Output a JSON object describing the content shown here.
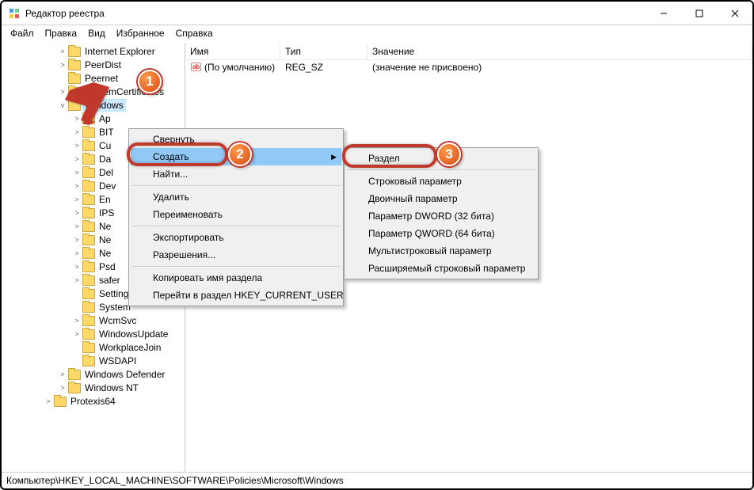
{
  "window": {
    "title": "Редактор реестра"
  },
  "menu": {
    "file": "Файл",
    "edit": "Правка",
    "view": "Вид",
    "favorites": "Избранное",
    "help": "Справка"
  },
  "list": {
    "headers": {
      "name": "Имя",
      "type": "Тип",
      "value": "Значение"
    },
    "row0": {
      "name": "(По умолчанию)",
      "type": "REG_SZ",
      "value": "(значение не присвоено)"
    }
  },
  "tree": {
    "ie": "Internet Explorer",
    "peerdist": "PeerDist",
    "peernet": "Peernet",
    "syscert": "SystemCertificates",
    "windows": "Windows",
    "ap": "Ap",
    "bit": "BIT",
    "cu": "Cu",
    "da": "Da",
    "del": "Del",
    "dev": "Dev",
    "enh": "En",
    "ips": "IPS",
    "ne1": "Ne",
    "ne2": "Ne",
    "ne3": "Ne",
    "psd": "Psd",
    "safer": "safer",
    "settingsync": "SettingSync",
    "system": "System",
    "wcmsvc": "WcmSvc",
    "winupdate": "WindowsUpdate",
    "workplace": "WorkplaceJoin",
    "wsdapi": "WSDAPI",
    "defender": "Windows Defender",
    "winnt": "Windows NT",
    "protexis": "Protexis64"
  },
  "ctx1": {
    "collapse": "Свернуть",
    "new": "Создать",
    "find": "Найти...",
    "delete": "Удалить",
    "rename": "Переименовать",
    "export": "Экспортировать",
    "permissions": "Разрешения...",
    "copyname": "Копировать имя раздела",
    "goto": "Перейти в раздел HKEY_CURRENT_USER"
  },
  "ctx2": {
    "key": "Раздел",
    "string": "Строковый параметр",
    "binary": "Двоичный параметр",
    "dword": "Параметр DWORD (32 бита)",
    "qword": "Параметр QWORD (64 бита)",
    "multi": "Мультистроковый параметр",
    "expand": "Расширяемый строковый параметр"
  },
  "status": {
    "path": "Компьютер\\HKEY_LOCAL_MACHINE\\SOFTWARE\\Policies\\Microsoft\\Windows"
  },
  "badges": {
    "b1": "1",
    "b2": "2",
    "b3": "3"
  }
}
